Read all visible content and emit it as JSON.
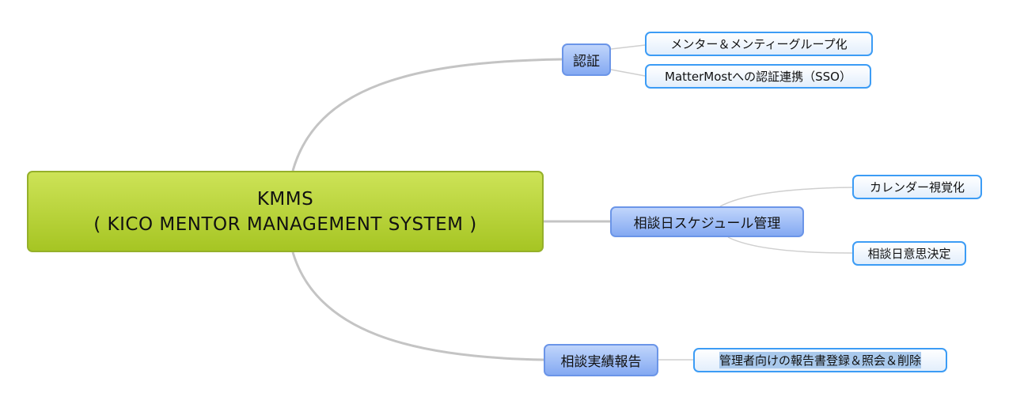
{
  "root": {
    "title": "KMMS",
    "subtitle": "( KICO MENTOR MANAGEMENT SYSTEM )"
  },
  "branches": [
    {
      "label": "認証",
      "children": [
        "メンター＆メンティーグループ化",
        "MatterMostへの認証連携（SSO）"
      ]
    },
    {
      "label": "相談日スケジュール管理",
      "children": [
        "カレンダー視覚化",
        "相談日意思決定"
      ]
    },
    {
      "label": "相談実績報告",
      "children": [
        "管理者向けの報告書登録＆照会＆削除"
      ]
    }
  ],
  "colors": {
    "root": "#b4d030",
    "branch": "#94b6f5",
    "leaf_border": "#3c9cf5",
    "connector": "#c0c0c0"
  }
}
